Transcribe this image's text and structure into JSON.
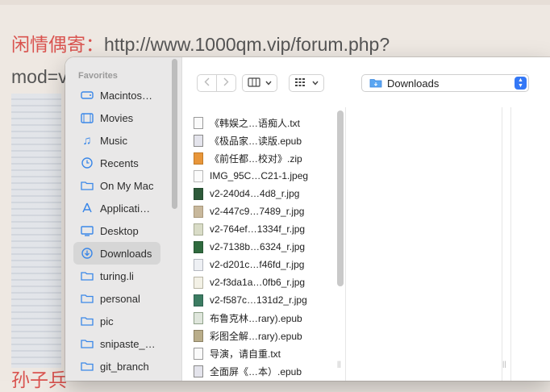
{
  "background_page": {
    "line1_prefix": "闲情偶寄：",
    "line1_url": "http://www.1000qm.vip/forum.php?",
    "line2": "mod=v",
    "footer": "孙子兵"
  },
  "sidebar": {
    "heading": "Favorites",
    "items": [
      {
        "label": "Macintos…",
        "icon": "disk-icon"
      },
      {
        "label": "Movies",
        "icon": "film-icon"
      },
      {
        "label": "Music",
        "icon": "music-icon"
      },
      {
        "label": "Recents",
        "icon": "clock-icon"
      },
      {
        "label": "On My Mac",
        "icon": "folder-icon"
      },
      {
        "label": "Applicati…",
        "icon": "applications-icon"
      },
      {
        "label": "Desktop",
        "icon": "desktop-icon"
      },
      {
        "label": "Downloads",
        "icon": "download-icon",
        "selected": true
      },
      {
        "label": "turing.li",
        "icon": "folder-icon"
      },
      {
        "label": "personal",
        "icon": "folder-icon"
      },
      {
        "label": "pic",
        "icon": "folder-icon"
      },
      {
        "label": "snipaste_…",
        "icon": "folder-icon"
      },
      {
        "label": "git_branch",
        "icon": "folder-icon"
      }
    ]
  },
  "toolbar": {
    "back_icon": "chevron-left-icon",
    "forward_icon": "chevron-right-icon",
    "view_columns_icon": "columns-view-icon",
    "group_icon": "grid-view-icon",
    "location": "Downloads",
    "location_icon": "blue-folder-icon"
  },
  "files": [
    {
      "name": "《韩娱之…语痴人.txt",
      "kind": "txt"
    },
    {
      "name": "《极品家…读版.epub",
      "kind": "epub"
    },
    {
      "name": "《前任都…校对》.zip",
      "kind": "zip"
    },
    {
      "name": "IMG_95C…C21-1.jpeg",
      "kind": "jpeg-light"
    },
    {
      "name": "v2-240d4…4d8_r.jpg",
      "kind": "jpg-green"
    },
    {
      "name": "v2-447c9…7489_r.jpg",
      "kind": "jpg-tan"
    },
    {
      "name": "v2-764ef…1334f_r.jpg",
      "kind": "jpg-sage"
    },
    {
      "name": "v2-7138b…6324_r.jpg",
      "kind": "jpg-darkgreen"
    },
    {
      "name": "v2-d201c…f46fd_r.jpg",
      "kind": "jpg-light"
    },
    {
      "name": "v2-f3da1a…0fb6_r.jpg",
      "kind": "jpg-cream"
    },
    {
      "name": "v2-f587c…131d2_r.jpg",
      "kind": "jpg-teal"
    },
    {
      "name": "布鲁克林…rary).epub",
      "kind": "epub"
    },
    {
      "name": "彩图全解…rary).epub",
      "kind": "epub2"
    },
    {
      "name": "导演，请自重.txt",
      "kind": "txt"
    },
    {
      "name": "全面屏《…本）.epub",
      "kind": "epub"
    }
  ],
  "colors": {
    "accent": "#3478f6",
    "sidebar_icon": "#3a87e8",
    "selected_row": "#d6d6d6",
    "bg_red_text": "#d9534f"
  }
}
